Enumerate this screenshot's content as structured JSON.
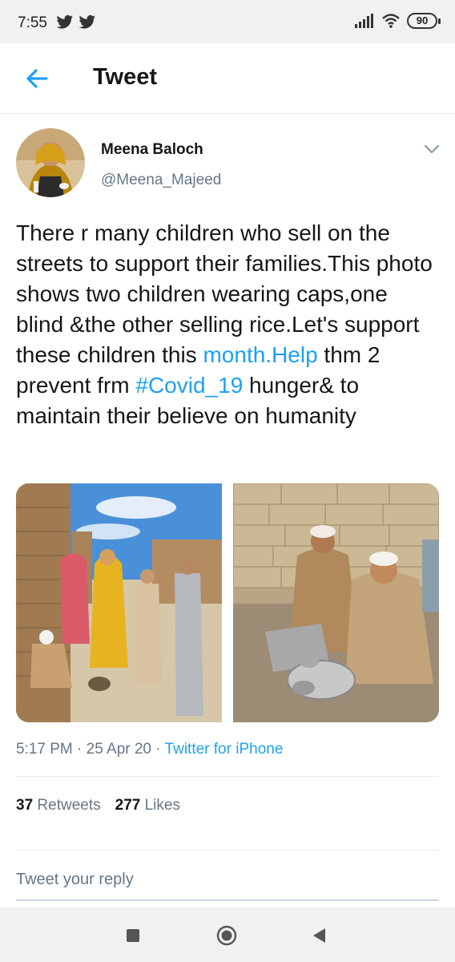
{
  "status_bar": {
    "time": "7:55",
    "battery": "90",
    "icons": [
      "twitter-bird-icon",
      "twitter-bird-icon",
      "signal-icon",
      "wifi-icon",
      "battery-icon"
    ]
  },
  "header": {
    "title": "Tweet",
    "back_icon": "back-arrow-icon"
  },
  "tweet": {
    "author_name": "Meena Baloch",
    "author_handle": "@Meena_Majeed",
    "text_before_link1": "There r many children who sell on the streets to support their families.This photo shows two children wearing caps,one blind &the other selling rice.Let's support these children this ",
    "link1": "month.Help",
    "text_between": " thm 2 prevent frm ",
    "link2": "#Covid_19",
    "text_after": " hunger& to maintain their believe on humanity",
    "time": "5:17 PM",
    "separator": "·",
    "date": "25 Apr 20",
    "source": "Twitter for iPhone",
    "retweets_count": "37",
    "retweets_label": "Retweets",
    "likes_count": "277",
    "likes_label": "Likes"
  },
  "reply": {
    "placeholder": "Tweet your reply"
  },
  "colors": {
    "accent": "#1da1f2",
    "secondary_text": "#657786",
    "primary_text": "#14171a"
  }
}
